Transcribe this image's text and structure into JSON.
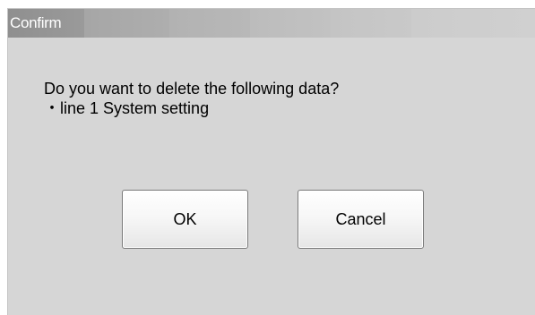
{
  "dialog": {
    "title": "Confirm",
    "message_line1": "Do you want to delete the following data?",
    "message_line2": "・line 1 System setting",
    "buttons": {
      "ok_label": "OK",
      "cancel_label": "Cancel"
    }
  }
}
